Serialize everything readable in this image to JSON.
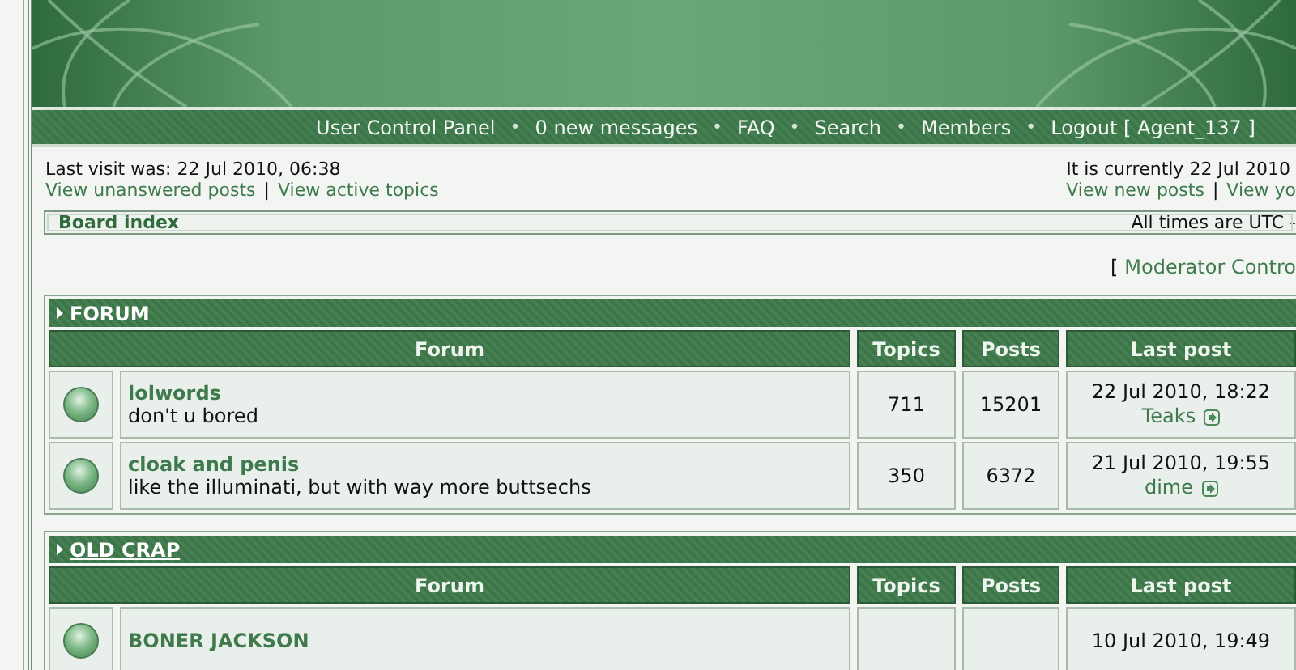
{
  "nav": {
    "separator": "•",
    "links": [
      "User Control Panel",
      "0 new messages",
      "FAQ",
      "Search",
      "Members",
      "Logout [ Agent_137 ]"
    ]
  },
  "info": {
    "last_visit": "Last visit was: 22 Jul 2010, 06:38",
    "left_links": [
      "View unanswered posts",
      "View active topics"
    ],
    "current_time": "It is currently 22 Jul 2010",
    "right_links": [
      "View new posts",
      "View yo"
    ],
    "link_separator": "|"
  },
  "breadcrumb": {
    "link": "Board index",
    "timezone": "All times are UTC -"
  },
  "moderator": {
    "bracket": "[",
    "link": "Moderator Contro"
  },
  "categories": [
    {
      "title": "FORUM",
      "underlined": false,
      "columns": [
        "Forum",
        "Topics",
        "Posts",
        "Last post"
      ],
      "forums": [
        {
          "name": "lolwords",
          "description": "don't u bored",
          "topics": "711",
          "posts": "15201",
          "last_post_time": "22 Jul 2010, 18:22",
          "last_post_author": "Teaks"
        },
        {
          "name": "cloak and penis",
          "description": "like the illuminati, but with way more buttsechs",
          "topics": "350",
          "posts": "6372",
          "last_post_time": "21 Jul 2010, 19:55",
          "last_post_author": "dime"
        }
      ]
    },
    {
      "title": "OLD CRAP",
      "underlined": true,
      "columns": [
        "Forum",
        "Topics",
        "Posts",
        "Last post"
      ],
      "forums": [
        {
          "name": "BONER JACKSON",
          "last_post_time": "10 Jul 2010, 19:49"
        }
      ]
    }
  ]
}
